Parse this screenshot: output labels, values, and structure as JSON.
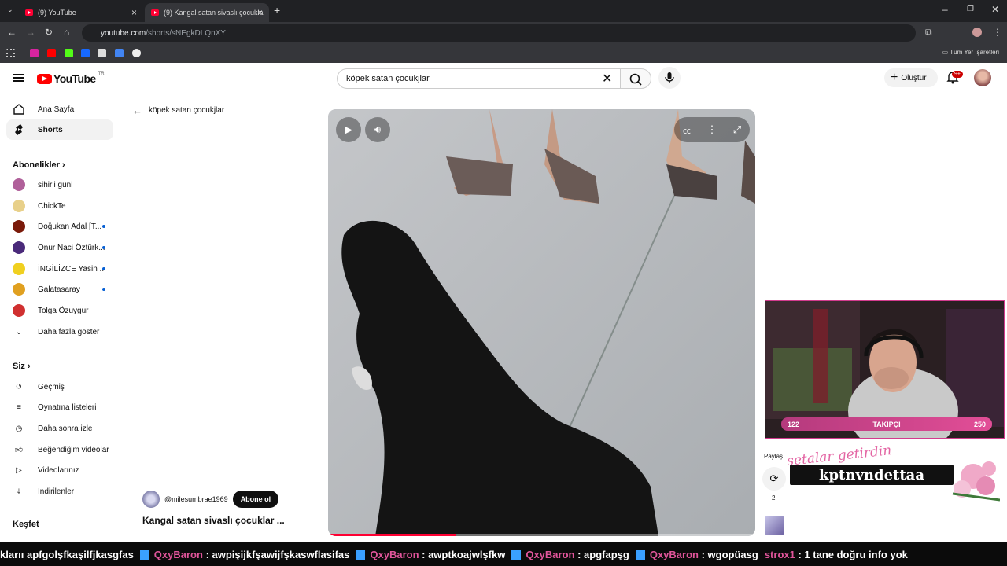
{
  "browser": {
    "tabs": [
      {
        "label": "(9) YouTube"
      },
      {
        "label": "(9) Kangal satan sivaslı çocukla"
      }
    ],
    "url_host": "youtube.com",
    "url_path": "/shorts/sNEgkDLQnXY",
    "bookmarks_all": "Tüm Yer İşaretleri"
  },
  "header": {
    "logo_text": "YouTube",
    "country_code": "TR",
    "search_value": "köpek satan çocukjlar",
    "create_label": "Oluştur",
    "notif_count": "9+"
  },
  "sidebar": {
    "main": [
      {
        "label": "Ana Sayfa",
        "icon": "home-icon"
      },
      {
        "label": "Shorts",
        "icon": "shorts-icon"
      }
    ],
    "subs_heading": "Abonelikler",
    "subscriptions": [
      {
        "label": "sihirli günl",
        "color": "#b0609a",
        "dot": false
      },
      {
        "label": "ChickTe",
        "color": "#e8d08a",
        "dot": false
      },
      {
        "label": "Doğukan Adal [T...",
        "color": "#7a1a0a",
        "dot": true
      },
      {
        "label": "Onur Naci Öztürk...",
        "color": "#4a2a7a",
        "dot": true
      },
      {
        "label": "İNGİLİZCE Yasin ...",
        "color": "#f0d020",
        "dot": true
      },
      {
        "label": "Galatasaray",
        "color": "#e0a020",
        "dot": true
      },
      {
        "label": "Tolga Özuygur",
        "color": "#d03030",
        "dot": false
      }
    ],
    "show_more": "Daha fazla göster",
    "you_heading": "Siz",
    "you_items": [
      {
        "label": "Geçmiş",
        "icon": "history-icon"
      },
      {
        "label": "Oynatma listeleri",
        "icon": "playlist-icon"
      },
      {
        "label": "Daha sonra izle",
        "icon": "watch-later-icon"
      },
      {
        "label": "Beğendiğim videolar",
        "icon": "like-icon"
      },
      {
        "label": "Videolarınız",
        "icon": "your-videos-icon"
      },
      {
        "label": "İndirilenler",
        "icon": "download-icon"
      }
    ],
    "explore_heading": "Keşfet"
  },
  "main": {
    "back_label": "köpek satan çocukjlar",
    "channel_handle": "@milesumbrae1969",
    "subscribe_label": "Abone ol",
    "video_title": "Kangal satan sivaslı çocuklar ...",
    "share_label": "Paylaş",
    "remix_count": "2",
    "progress": 0.3
  },
  "overlay": {
    "followers_current": "122",
    "followers_label": "TAKİPÇİ",
    "followers_goal": "250",
    "banner_script": "setalar getirdin",
    "banner_name": "kptnvndettaa",
    "ticker": [
      {
        "user": "",
        "msg": "klarıı apfgolşfkaşilfjkasgfas"
      },
      {
        "user": "QxyBaron",
        "msg": ": awpişijkfşawijfşkaswflasifas"
      },
      {
        "user": "QxyBaron",
        "msg": ": awptkoajwlşfkw"
      },
      {
        "user": "QxyBaron",
        "msg": ": apgfapşg"
      },
      {
        "user": "QxyBaron",
        "msg": ": wgopüasg"
      },
      {
        "user": "strox1",
        "msg": ": 1 tane doğru info yok"
      }
    ]
  }
}
